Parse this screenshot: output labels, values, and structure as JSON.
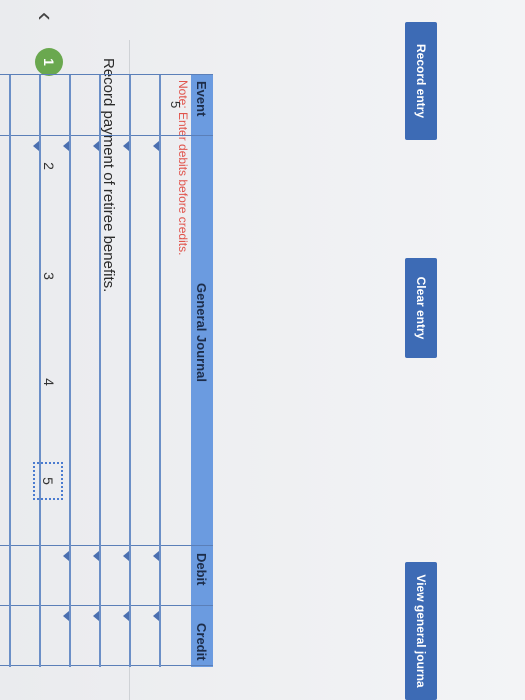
{
  "nav": {
    "back_icon": "chevron-left-icon",
    "steps": [
      "1",
      "2",
      "3",
      "4",
      "5"
    ]
  },
  "instruction": "Record payment of retiree benefits.",
  "note": "Note: Enter debits before credits.",
  "journal": {
    "headers": {
      "event": "Event",
      "general_journal": "General Journal",
      "debit": "Debit",
      "credit": "Credit"
    },
    "event_value": "5"
  },
  "buttons": {
    "record": "Record entry",
    "clear": "Clear entry",
    "view": "View general journa"
  },
  "colors": {
    "header": "#6b9be0",
    "button": "#3d6bb5",
    "step_done": "#6aa84f",
    "note": "#e0544c"
  }
}
